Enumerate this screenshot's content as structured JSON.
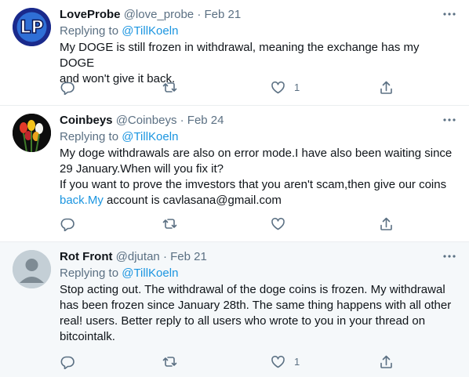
{
  "tweets": [
    {
      "name": "LoveProbe",
      "handle": "@love_probe",
      "dot": "·",
      "date": "Feb 21",
      "replying_prefix": "Replying to ",
      "replying_to": "@TillKoeln",
      "text_lines": [
        "My DOGE is still frozen in withdrawal, meaning the exchange has my DOGE",
        "and won't give it back."
      ],
      "like_count": "1",
      "avatar_text": "LP"
    },
    {
      "name": "Coinbeys",
      "handle": "@Coinbeys",
      "dot": "·",
      "date": "Feb 24",
      "replying_prefix": "Replying to ",
      "replying_to": "@TillKoeln",
      "text_lines": [
        "My doge withdrawals are also on error mode.I have also been waiting since",
        "29 January.When will you fix it?",
        "If you want to prove the imvestors that you aren't scam,then give our coins"
      ],
      "text_link": "back.My",
      "text_after_link": " account is cavlasana@gmail.com",
      "like_count": ""
    },
    {
      "name": "Rot Front",
      "handle": "@djutan",
      "dot": "·",
      "date": "Feb 21",
      "replying_prefix": "Replying to ",
      "replying_to": "@TillKoeln",
      "text_lines": [
        "Stop acting out. The withdrawal of the doge coins is frozen. My withdrawal",
        "has been frozen since January 28th. The same thing happens with all other",
        "real! users. Better reply to all users who wrote to you in your thread on",
        "bitcointalk."
      ],
      "like_count": "1"
    }
  ],
  "colors": {
    "link": "#1b95e0",
    "muted": "#5b7083",
    "highlight_bg": "#f5f8fa"
  },
  "icons": [
    "more-icon",
    "reply-icon",
    "retweet-icon",
    "like-icon",
    "share-icon"
  ]
}
